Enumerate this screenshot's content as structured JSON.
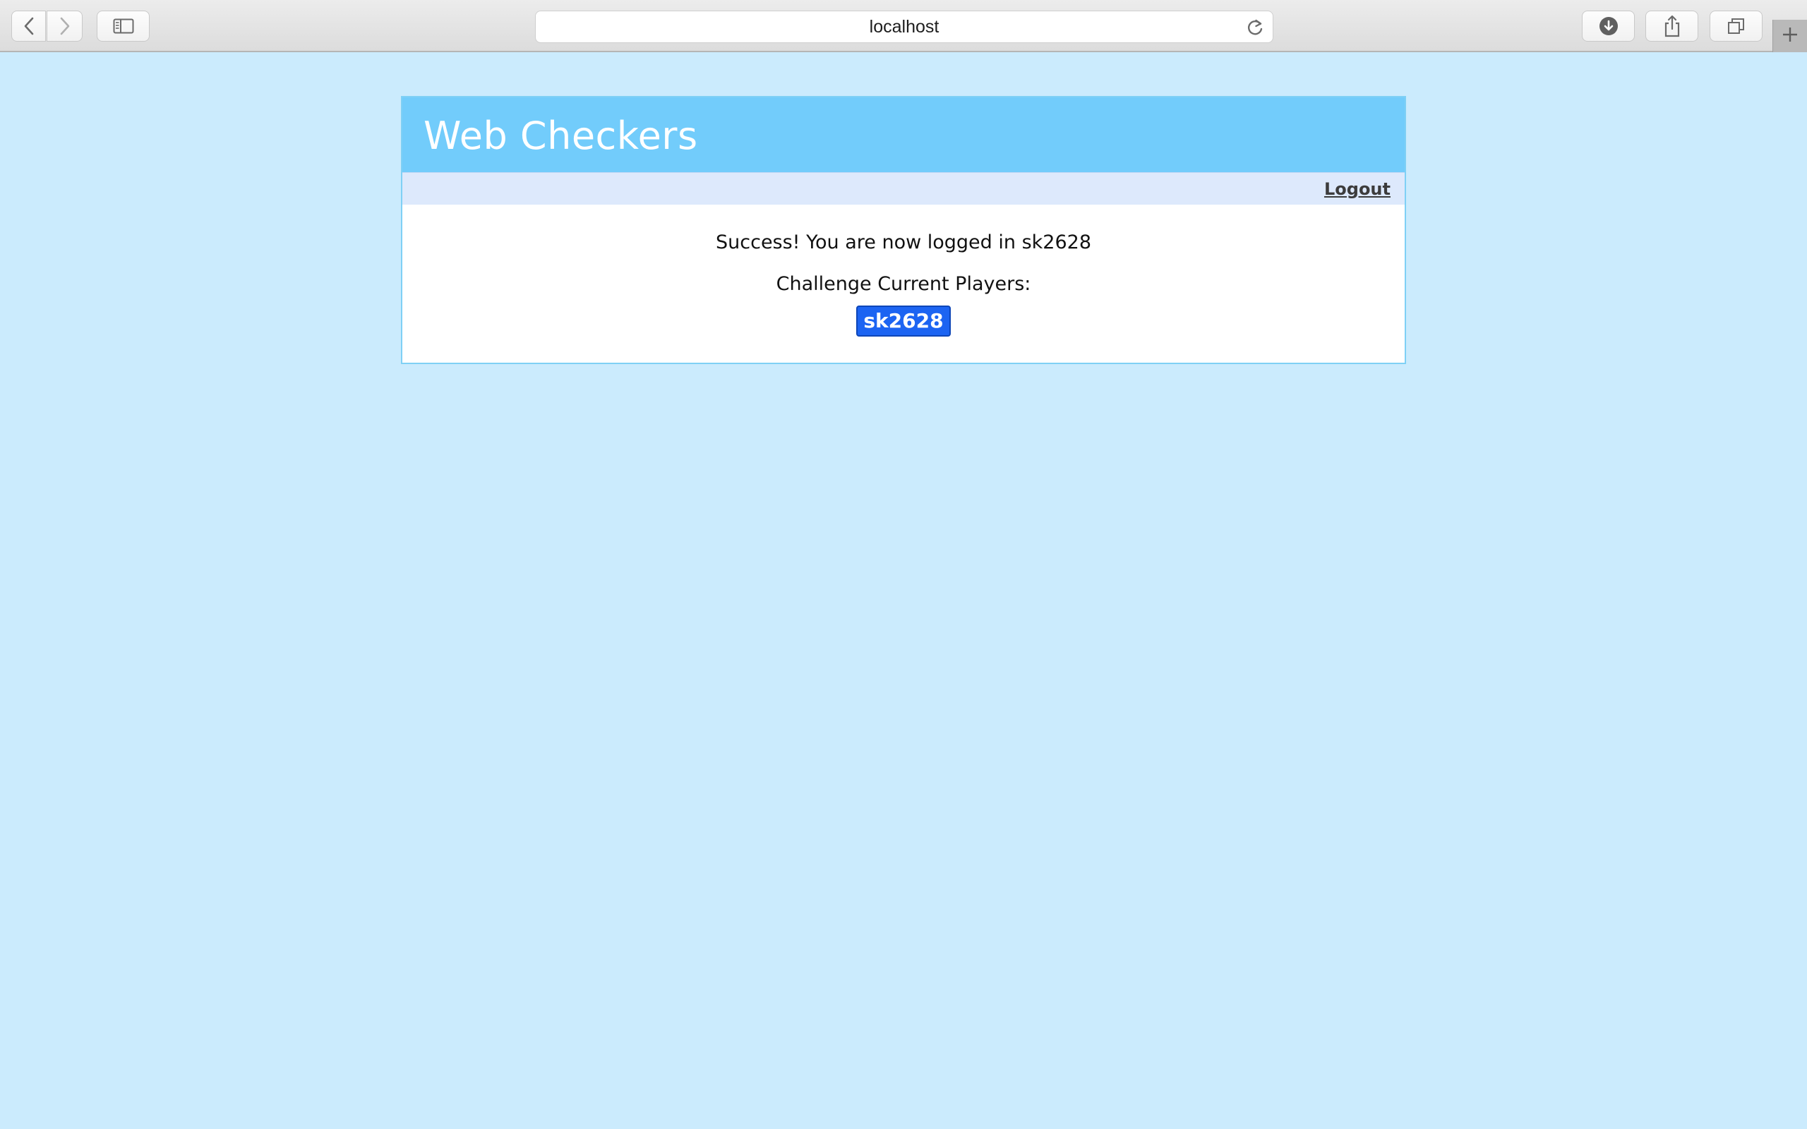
{
  "browser": {
    "address": "localhost",
    "icons": {
      "back": "chevron-left-icon",
      "forward": "chevron-right-icon",
      "sidebar": "sidebar-icon",
      "reload": "reload-icon",
      "download": "download-icon",
      "share": "share-icon",
      "tabs": "tabs-overview-icon",
      "new_tab": "plus-icon"
    }
  },
  "app": {
    "title": "Web Checkers",
    "nav": {
      "logout": "Logout"
    },
    "message": "Success! You are now logged in sk2628",
    "challenge_label": "Challenge Current Players:",
    "players": [
      "sk2628"
    ]
  },
  "colors": {
    "page_background": "#cbebfd",
    "header_background": "#72ccfb",
    "navbar_background": "#dde9fc",
    "player_button": "#1c64f2"
  }
}
